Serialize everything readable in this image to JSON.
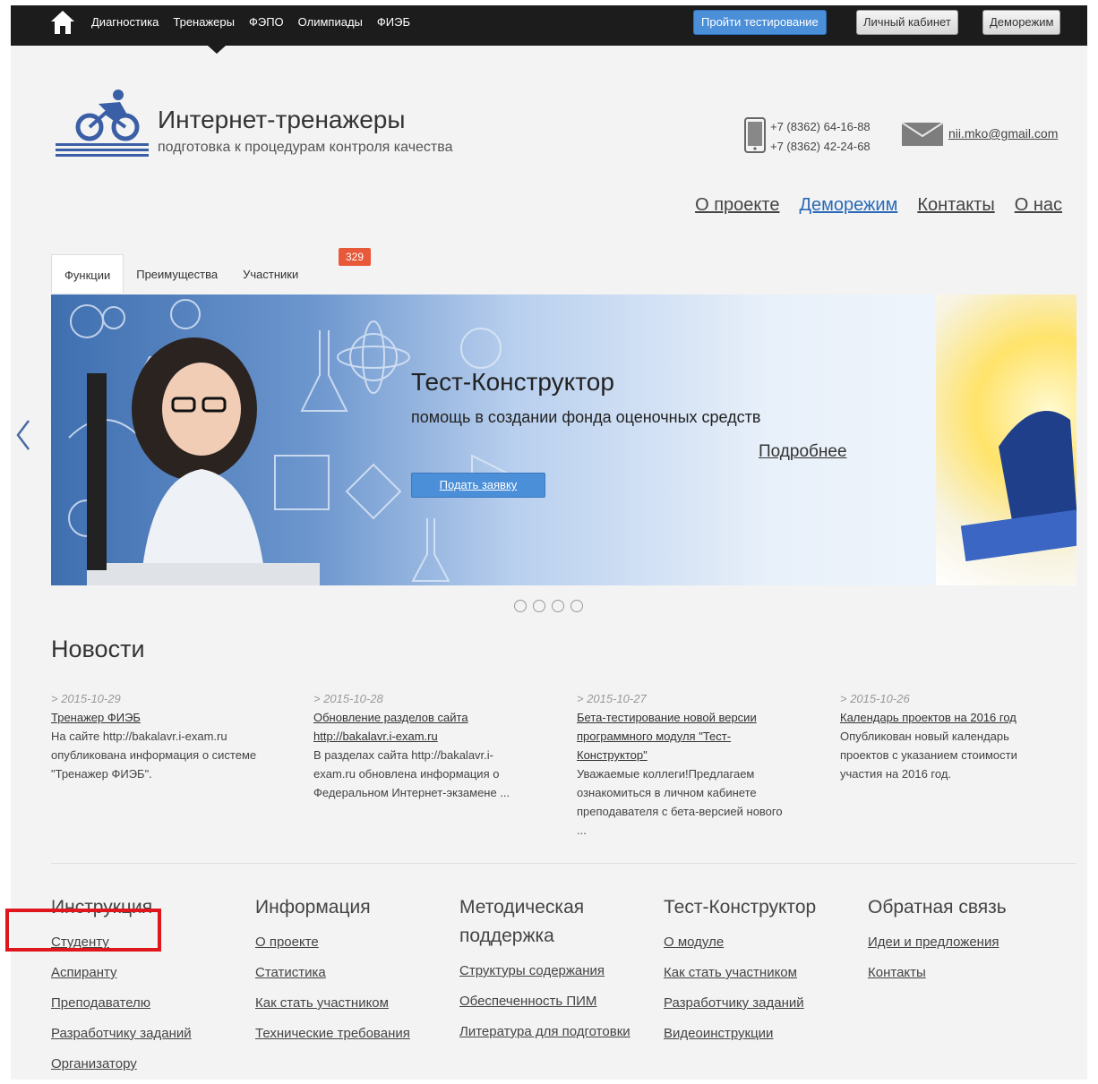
{
  "topbar": {
    "nav": [
      "Диагностика",
      "Тренажеры",
      "ФЭПО",
      "Олимпиады",
      "ФИЭБ"
    ],
    "test_button": "Пройти тестирование",
    "cabinet_button": "Личный кабинет",
    "demo_button": "Деморежим"
  },
  "header": {
    "title": "Интернет-тренажеры",
    "subtitle": "подготовка к процедурам контроля качества",
    "phones": [
      "+7 (8362) 64-16-88",
      "+7 (8362) 42-24-68"
    ],
    "email": "nii.mko@gmail.com",
    "nav": [
      {
        "label": "О проекте",
        "accent": false
      },
      {
        "label": "Деморежим",
        "accent": true
      },
      {
        "label": "Контакты",
        "accent": false
      },
      {
        "label": "О нас",
        "accent": false
      }
    ]
  },
  "tabs": [
    {
      "label": "Функции",
      "active": true
    },
    {
      "label": "Преимущества",
      "active": false
    },
    {
      "label": "Участники",
      "active": false
    }
  ],
  "tab_badge": "329",
  "banner": {
    "title": "Тест-Конструктор",
    "subtitle": "помощь в создании фонда оценочных средств",
    "more_link": "Подробнее",
    "apply_button": "Подать заявку",
    "slide_count": 4
  },
  "news": {
    "heading": "Новости",
    "items": [
      {
        "date": "> 2015-10-29",
        "title": "Тренажер ФИЭБ",
        "text": "На сайте http://bakalavr.i-exam.ru опубликована информация о системе \"Тренажер ФИЭБ\"."
      },
      {
        "date": "> 2015-10-28",
        "title": "Обновление разделов сайта http://bakalavr.i-exam.ru",
        "text": "В разделах сайта http://bakalavr.i-exam.ru обновлена информация о Федеральном Интернет-экзамене ..."
      },
      {
        "date": "> 2015-10-27",
        "title": "Бета-тестирование новой версии программного модуля \"Тест-Конструктор\"",
        "text": "Уважаемые коллеги!Предлагаем ознакомиться в личном кабинете преподавателя с бета-версией нового ..."
      },
      {
        "date": "> 2015-10-26",
        "title": "Календарь проектов на 2016 год",
        "text": "Опубликован новый календарь проектов с указанием стоимости участия на 2016 год."
      }
    ]
  },
  "footer": [
    {
      "heading": "Инструкция",
      "links": [
        "Студенту",
        "Аспиранту",
        "Преподавателю",
        "Разработчику заданий",
        "Организатору"
      ]
    },
    {
      "heading": "Информация",
      "links": [
        "О проекте",
        "Статистика",
        "Как стать участником",
        "Технические требования"
      ]
    },
    {
      "heading": "Методическая поддержка",
      "links": [
        "Структуры содержания",
        "Обеспеченность ПИМ",
        "Литература для подготовки"
      ]
    },
    {
      "heading": "Тест-Конструктор",
      "links": [
        "О модуле",
        "Как стать участником",
        "Разработчику заданий",
        "Видеоинструкции"
      ]
    },
    {
      "heading": "Обратная связь",
      "links": [
        "Идеи и предложения",
        "Контакты"
      ]
    }
  ],
  "colors": {
    "accent": "#4a8fd8",
    "topbar": "#1c1c1c",
    "badge": "#e8593a",
    "highlight": "#e0161d"
  }
}
